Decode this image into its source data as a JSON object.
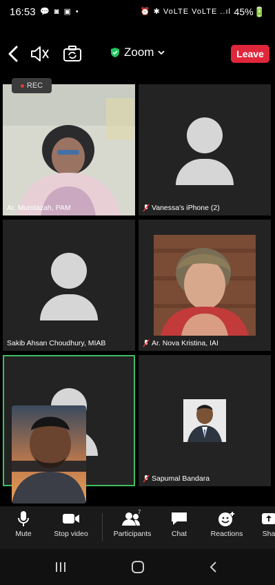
{
  "status_bar": {
    "time": "16:53",
    "left_icons": "💬 ◙ ▣ •",
    "right_icons": "⏰ ✱ VoLTE VoLTE ..ıl",
    "battery": "45%🔋"
  },
  "header": {
    "title": "Zoom",
    "leave_label": "Leave",
    "accent_colors": {
      "leave": "#e0263a",
      "secure": "#22c55e",
      "active_speaker": "#3fbf5f"
    }
  },
  "recording": {
    "label": "REC"
  },
  "participants": [
    {
      "name": "Ar. Mumtazah, PAM",
      "muted": false,
      "video": true
    },
    {
      "name": "Vanessa's iPhone (2)",
      "muted": true,
      "video": false
    },
    {
      "name": "Sakib Ahsan Choudhury, MIAB",
      "muted": false,
      "video": false
    },
    {
      "name": "Ar. Nova Kristina, IAI",
      "muted": true,
      "video": true
    },
    {
      "name": "",
      "muted": false,
      "video": false,
      "active_speaker": true
    },
    {
      "name": "Sapumal Bandara",
      "muted": true,
      "video": true
    }
  ],
  "toolbar": {
    "mute": "Mute",
    "stop_video": "Stop video",
    "participants": "Participants",
    "participants_count": "7",
    "chat": "Chat",
    "reactions": "Reactions",
    "share": "Sha"
  }
}
